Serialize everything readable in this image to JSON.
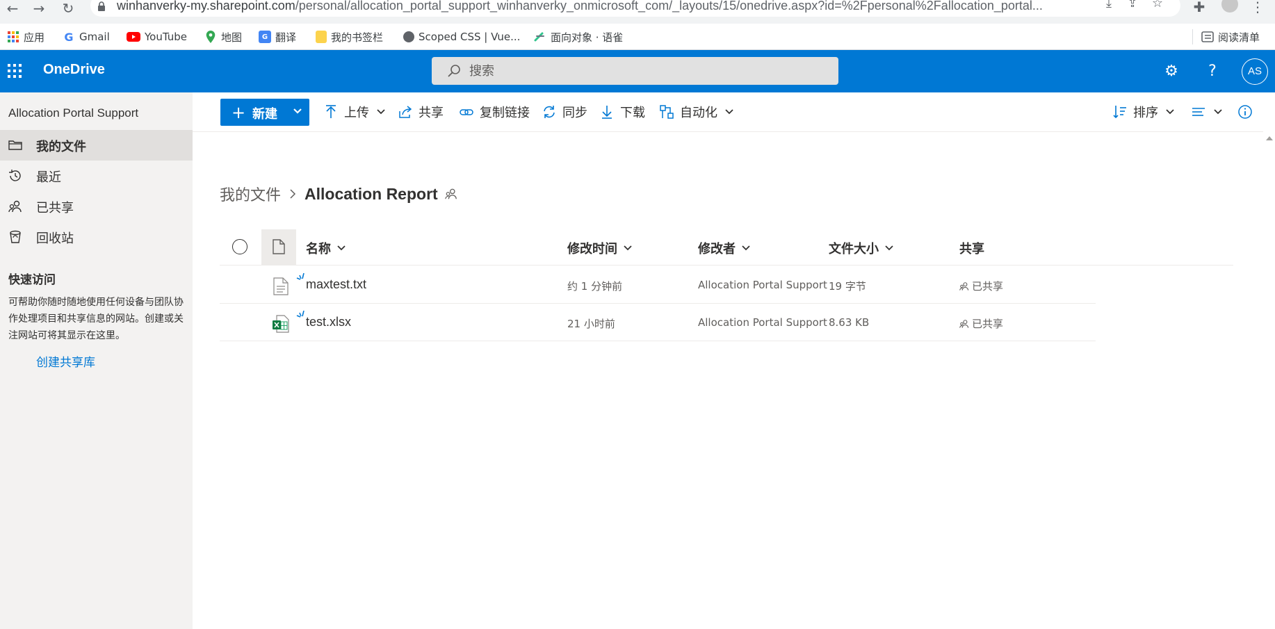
{
  "browser": {
    "url": "winhanverky-my.sharepoint.com/personal/allocation_portal_support_winhanverky_onmicrosoft_com/_layouts/15/onedrive.aspx?id=%2Fpersonal%2Fallocation_portal...",
    "url_host": "winhanverky-my.sharepoint.com",
    "url_path": "/personal/allocation_portal_support_winhanverky_onmicrosoft_com/_layouts/15/onedrive.aspx?id=%2Fpersonal%2Fallocation_portal...",
    "bookmarks": [
      {
        "label": "应用",
        "icon": "apps-grid-icon"
      },
      {
        "label": "Gmail",
        "icon": "google-g-icon"
      },
      {
        "label": "YouTube",
        "icon": "youtube-icon"
      },
      {
        "label": "地图",
        "icon": "maps-pin-icon"
      },
      {
        "label": "翻译",
        "icon": "translate-icon"
      },
      {
        "label": "我的书签栏",
        "icon": "folder-icon"
      },
      {
        "label": "Scoped CSS | Vue...",
        "icon": "globe-icon"
      },
      {
        "label": "面向对象 · 语雀",
        "icon": "yuque-icon"
      }
    ],
    "reading_list": "阅读清单"
  },
  "suite": {
    "brand": "OneDrive",
    "search_placeholder": "搜索",
    "avatar_initials": "AS",
    "accent": "#0078d4"
  },
  "leftnav": {
    "title": "Allocation Portal Support",
    "items": [
      {
        "label": "我的文件",
        "icon": "folder-icon",
        "selected": true
      },
      {
        "label": "最近",
        "icon": "history-icon"
      },
      {
        "label": "已共享",
        "icon": "people-icon"
      },
      {
        "label": "回收站",
        "icon": "recycle-bin-icon"
      }
    ],
    "quick_access_title": "快速访问",
    "quick_access_desc": "可帮助你随时随地使用任何设备与团队协作处理项目和共享信息的网站。创建或关注网站可将其显示在这里。",
    "create_link": "创建共享库"
  },
  "commands": {
    "new": "新建",
    "upload": "上传",
    "share": "共享",
    "copy_link": "复制链接",
    "sync": "同步",
    "download": "下载",
    "automate": "自动化",
    "sort": "排序"
  },
  "breadcrumb": {
    "root": "我的文件",
    "current": "Allocation Report"
  },
  "table": {
    "headers": {
      "name": "名称",
      "modified": "修改时间",
      "modified_by": "修改者",
      "size": "文件大小",
      "sharing": "共享"
    },
    "rows": [
      {
        "name": "maxtest.txt",
        "type": "text-file-icon",
        "modified": "约 1 分钟前",
        "modified_by": "Allocation Portal Support",
        "size": "19 字节",
        "sharing": "已共享"
      },
      {
        "name": "test.xlsx",
        "type": "excel-file-icon",
        "modified": "21 小时前",
        "modified_by": "Allocation Portal Support",
        "size": "8.63 KB",
        "sharing": "已共享"
      }
    ]
  }
}
